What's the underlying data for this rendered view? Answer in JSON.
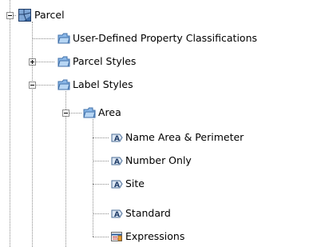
{
  "tree": {
    "root": {
      "label": "Parcel",
      "icon": "parcel-icon",
      "expanded": true
    },
    "items": [
      {
        "label": "User-Defined Property Classifications",
        "icon": "folder-icon"
      },
      {
        "label": "Parcel Styles",
        "icon": "folder-icon",
        "expanded": false
      },
      {
        "label": "Label Styles",
        "icon": "folder-icon",
        "expanded": true
      },
      {
        "label": "Area",
        "icon": "folder-icon",
        "expanded": true
      },
      {
        "label": "Name Area & Perimeter",
        "icon": "label-style-icon"
      },
      {
        "label": "Number Only",
        "icon": "label-style-icon"
      },
      {
        "label": "Site",
        "icon": "label-style-icon"
      },
      {
        "label": "Standard",
        "icon": "label-style-icon"
      },
      {
        "label": "Expressions",
        "icon": "expressions-icon"
      }
    ]
  },
  "colors": {
    "folder_blue": "#7aaee0",
    "connector": "#8c8c8c",
    "parcel_blue": "#3b6aa6"
  }
}
